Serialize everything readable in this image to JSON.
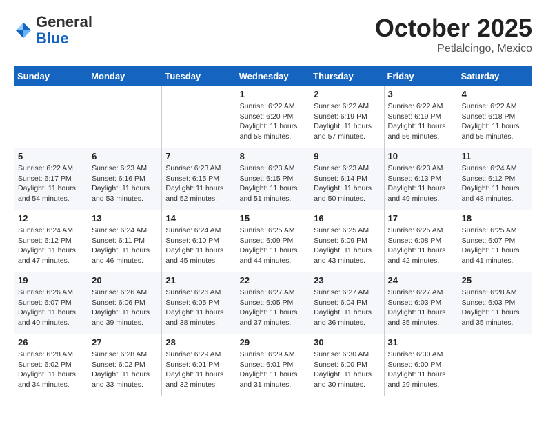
{
  "header": {
    "logo": {
      "general": "General",
      "blue": "Blue"
    },
    "month": "October 2025",
    "location": "Petlalcingo, Mexico"
  },
  "weekdays": [
    "Sunday",
    "Monday",
    "Tuesday",
    "Wednesday",
    "Thursday",
    "Friday",
    "Saturday"
  ],
  "weeks": [
    [
      {
        "day": "",
        "info": ""
      },
      {
        "day": "",
        "info": ""
      },
      {
        "day": "",
        "info": ""
      },
      {
        "day": "1",
        "info": "Sunrise: 6:22 AM\nSunset: 6:20 PM\nDaylight: 11 hours\nand 58 minutes."
      },
      {
        "day": "2",
        "info": "Sunrise: 6:22 AM\nSunset: 6:19 PM\nDaylight: 11 hours\nand 57 minutes."
      },
      {
        "day": "3",
        "info": "Sunrise: 6:22 AM\nSunset: 6:19 PM\nDaylight: 11 hours\nand 56 minutes."
      },
      {
        "day": "4",
        "info": "Sunrise: 6:22 AM\nSunset: 6:18 PM\nDaylight: 11 hours\nand 55 minutes."
      }
    ],
    [
      {
        "day": "5",
        "info": "Sunrise: 6:22 AM\nSunset: 6:17 PM\nDaylight: 11 hours\nand 54 minutes."
      },
      {
        "day": "6",
        "info": "Sunrise: 6:23 AM\nSunset: 6:16 PM\nDaylight: 11 hours\nand 53 minutes."
      },
      {
        "day": "7",
        "info": "Sunrise: 6:23 AM\nSunset: 6:15 PM\nDaylight: 11 hours\nand 52 minutes."
      },
      {
        "day": "8",
        "info": "Sunrise: 6:23 AM\nSunset: 6:15 PM\nDaylight: 11 hours\nand 51 minutes."
      },
      {
        "day": "9",
        "info": "Sunrise: 6:23 AM\nSunset: 6:14 PM\nDaylight: 11 hours\nand 50 minutes."
      },
      {
        "day": "10",
        "info": "Sunrise: 6:23 AM\nSunset: 6:13 PM\nDaylight: 11 hours\nand 49 minutes."
      },
      {
        "day": "11",
        "info": "Sunrise: 6:24 AM\nSunset: 6:12 PM\nDaylight: 11 hours\nand 48 minutes."
      }
    ],
    [
      {
        "day": "12",
        "info": "Sunrise: 6:24 AM\nSunset: 6:12 PM\nDaylight: 11 hours\nand 47 minutes."
      },
      {
        "day": "13",
        "info": "Sunrise: 6:24 AM\nSunset: 6:11 PM\nDaylight: 11 hours\nand 46 minutes."
      },
      {
        "day": "14",
        "info": "Sunrise: 6:24 AM\nSunset: 6:10 PM\nDaylight: 11 hours\nand 45 minutes."
      },
      {
        "day": "15",
        "info": "Sunrise: 6:25 AM\nSunset: 6:09 PM\nDaylight: 11 hours\nand 44 minutes."
      },
      {
        "day": "16",
        "info": "Sunrise: 6:25 AM\nSunset: 6:09 PM\nDaylight: 11 hours\nand 43 minutes."
      },
      {
        "day": "17",
        "info": "Sunrise: 6:25 AM\nSunset: 6:08 PM\nDaylight: 11 hours\nand 42 minutes."
      },
      {
        "day": "18",
        "info": "Sunrise: 6:25 AM\nSunset: 6:07 PM\nDaylight: 11 hours\nand 41 minutes."
      }
    ],
    [
      {
        "day": "19",
        "info": "Sunrise: 6:26 AM\nSunset: 6:07 PM\nDaylight: 11 hours\nand 40 minutes."
      },
      {
        "day": "20",
        "info": "Sunrise: 6:26 AM\nSunset: 6:06 PM\nDaylight: 11 hours\nand 39 minutes."
      },
      {
        "day": "21",
        "info": "Sunrise: 6:26 AM\nSunset: 6:05 PM\nDaylight: 11 hours\nand 38 minutes."
      },
      {
        "day": "22",
        "info": "Sunrise: 6:27 AM\nSunset: 6:05 PM\nDaylight: 11 hours\nand 37 minutes."
      },
      {
        "day": "23",
        "info": "Sunrise: 6:27 AM\nSunset: 6:04 PM\nDaylight: 11 hours\nand 36 minutes."
      },
      {
        "day": "24",
        "info": "Sunrise: 6:27 AM\nSunset: 6:03 PM\nDaylight: 11 hours\nand 35 minutes."
      },
      {
        "day": "25",
        "info": "Sunrise: 6:28 AM\nSunset: 6:03 PM\nDaylight: 11 hours\nand 35 minutes."
      }
    ],
    [
      {
        "day": "26",
        "info": "Sunrise: 6:28 AM\nSunset: 6:02 PM\nDaylight: 11 hours\nand 34 minutes."
      },
      {
        "day": "27",
        "info": "Sunrise: 6:28 AM\nSunset: 6:02 PM\nDaylight: 11 hours\nand 33 minutes."
      },
      {
        "day": "28",
        "info": "Sunrise: 6:29 AM\nSunset: 6:01 PM\nDaylight: 11 hours\nand 32 minutes."
      },
      {
        "day": "29",
        "info": "Sunrise: 6:29 AM\nSunset: 6:01 PM\nDaylight: 11 hours\nand 31 minutes."
      },
      {
        "day": "30",
        "info": "Sunrise: 6:30 AM\nSunset: 6:00 PM\nDaylight: 11 hours\nand 30 minutes."
      },
      {
        "day": "31",
        "info": "Sunrise: 6:30 AM\nSunset: 6:00 PM\nDaylight: 11 hours\nand 29 minutes."
      },
      {
        "day": "",
        "info": ""
      }
    ]
  ]
}
